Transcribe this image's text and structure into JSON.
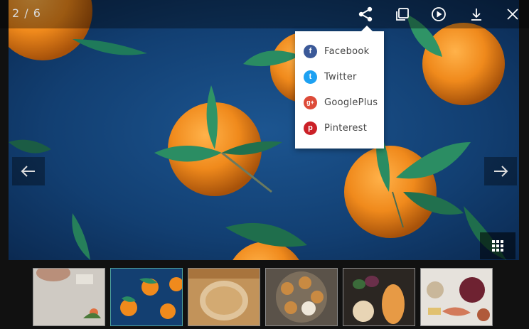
{
  "viewer": {
    "counter": "2 / 6",
    "toolbar": {
      "share": "share-icon",
      "fullscreen": "fullscreen-icon",
      "play": "play-icon",
      "download": "download-icon",
      "close": "close-icon"
    }
  },
  "share_menu": {
    "items": [
      {
        "label": "Facebook",
        "icon": "facebook-icon",
        "glyph": "f",
        "color": "#3b5998"
      },
      {
        "label": "Twitter",
        "icon": "twitter-icon",
        "glyph": "t",
        "color": "#1da1f2"
      },
      {
        "label": "GooglePlus",
        "icon": "googleplus-icon",
        "glyph": "g+",
        "color": "#dd4b39"
      },
      {
        "label": "Pinterest",
        "icon": "pinterest-icon",
        "glyph": "p",
        "color": "#cb2027"
      }
    ]
  },
  "thumbnails": {
    "count": 6,
    "active_index": 1,
    "subjects": [
      "plate",
      "tangerines",
      "bread",
      "cookies",
      "squash",
      "platter"
    ]
  },
  "colors": {
    "accent": "#4fa3a0",
    "background": "#111111",
    "photo_blue": "#123d6f"
  }
}
